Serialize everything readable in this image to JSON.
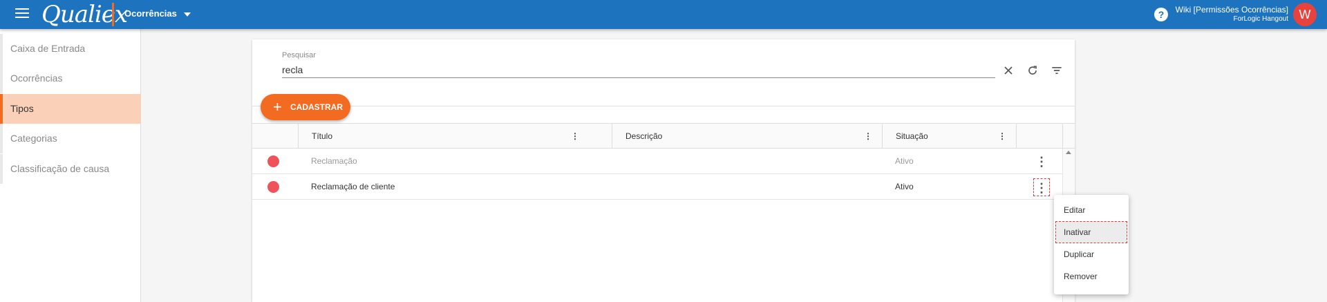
{
  "header": {
    "logo_text": "Qualiex",
    "module_label": "Ocorrências",
    "user_name": "Wiki [Permissões Ocorrências]",
    "user_org": "ForLogic Hangout",
    "avatar_letter": "W",
    "help_symbol": "?"
  },
  "sidebar": {
    "items": [
      {
        "label": "Caixa de Entrada"
      },
      {
        "label": "Ocorrências"
      },
      {
        "label": "Tipos",
        "active": true
      },
      {
        "label": "Categorias"
      },
      {
        "label": "Classificação de causa"
      }
    ]
  },
  "search": {
    "label": "Pesquisar",
    "value": "recla"
  },
  "toolbar": {
    "add_label": "CADASTRAR"
  },
  "table": {
    "columns": [
      "Título",
      "Descrição",
      "Situação"
    ],
    "rows": [
      {
        "title": "Reclamação",
        "description": "",
        "status": "Ativo",
        "muted": true
      },
      {
        "title": "Reclamação de cliente",
        "description": "",
        "status": "Ativo",
        "muted": false
      }
    ]
  },
  "row_menu": {
    "items": [
      "Editar",
      "Inativar",
      "Duplicar",
      "Remover"
    ]
  },
  "colors": {
    "topbar": "#1e73be",
    "accent": "#f26b21",
    "status_dot": "#f0525a",
    "sidebar_active": "#fad0b8"
  }
}
